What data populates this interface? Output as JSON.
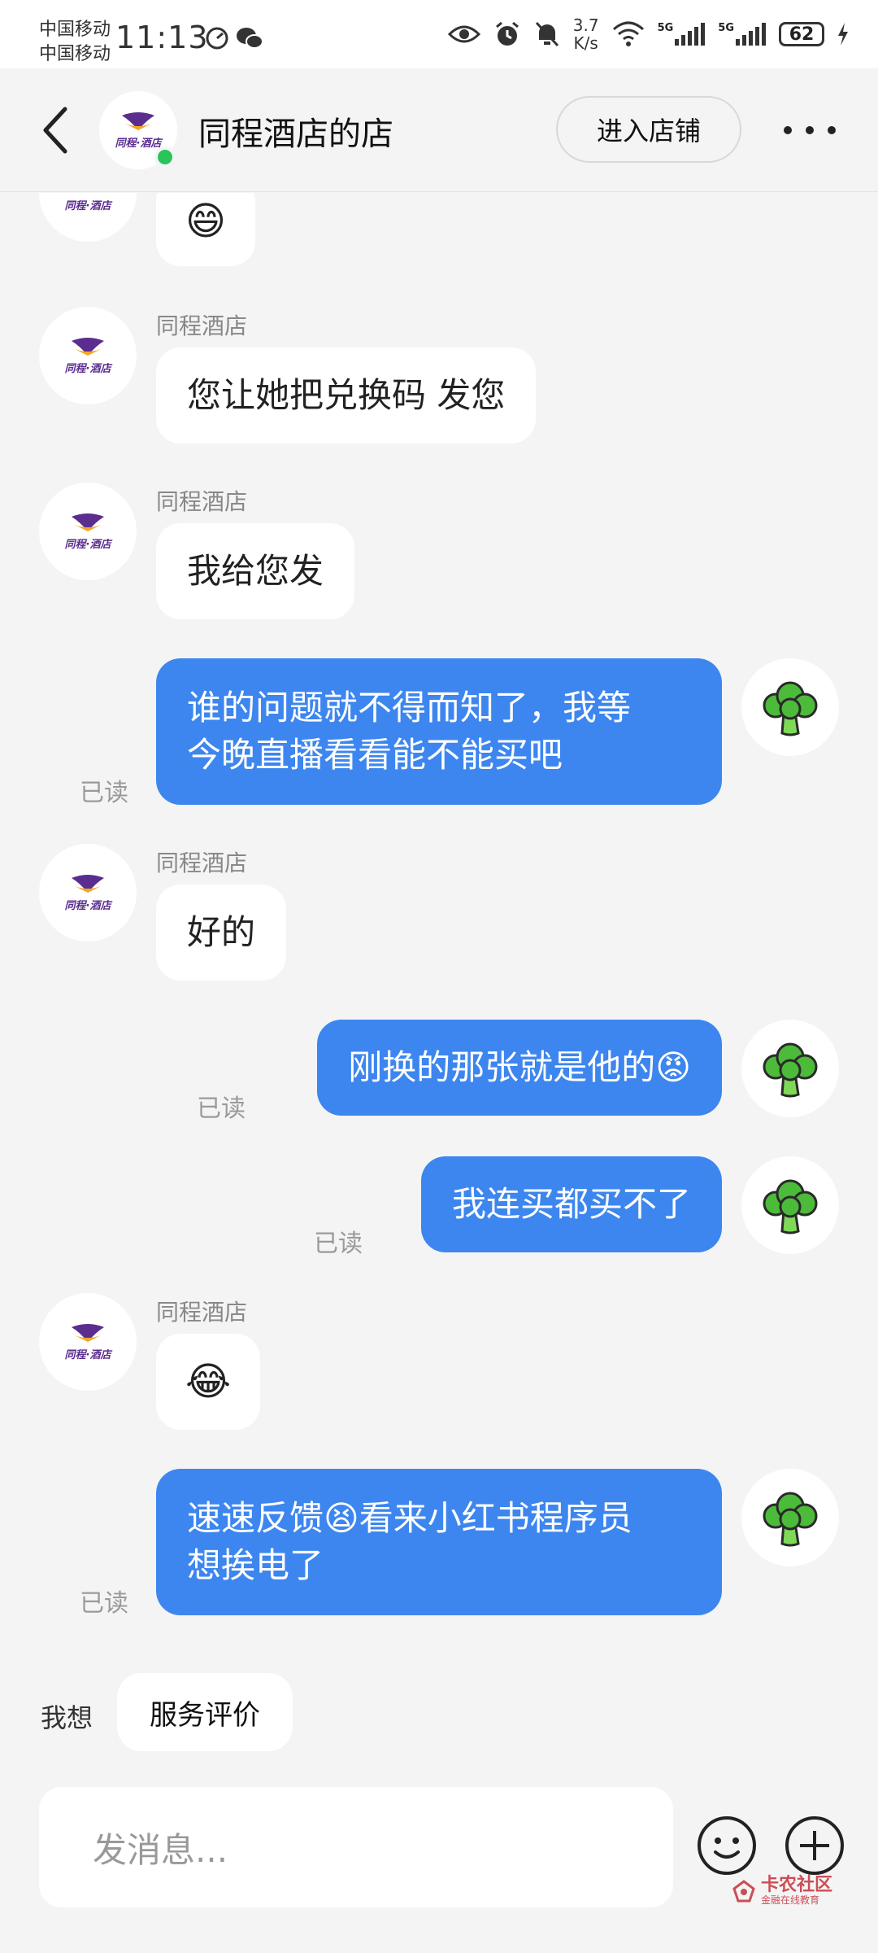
{
  "status_bar": {
    "carrier_1": "中国移动",
    "carrier_2": "中国移动",
    "time": "11:13",
    "net_speed_value": "3.7",
    "net_speed_unit": "K/s",
    "signal_1_label": "5G",
    "signal_2_label": "5G",
    "battery": "62"
  },
  "header": {
    "shop_name": "同程酒店的店",
    "enter_shop_label": "进入店铺",
    "logo_text": "同程·酒店",
    "online_status_color": "#2bc45a"
  },
  "chat": {
    "partial_top_emoji": "😄",
    "messages": [
      {
        "sender": "同程酒店",
        "text": "您让她把兑换码 发您"
      },
      {
        "sender": "同程酒店",
        "text": "我给您发"
      },
      {
        "text_line_1": "谁的问题就不得而知了，我等",
        "text_line_2": "今晚直播看看能不能买吧",
        "status": "已读"
      },
      {
        "sender": "同程酒店",
        "text": "好的"
      },
      {
        "text": "刚换的那张就是他的😡",
        "status": "已读"
      },
      {
        "text": "我连买都买不了",
        "status": "已读"
      },
      {
        "sender": "同程酒店",
        "text": "😂"
      },
      {
        "text_line_1": "速速反馈😫看来小红书程序员",
        "text_line_2": "想挨电了",
        "status": "已读"
      }
    ]
  },
  "bottom": {
    "want_label": "我想",
    "quick_reply": "服务评价",
    "input_placeholder": "发消息..."
  },
  "watermark": {
    "title": "卡农社区",
    "subtitle": "金融在线教育"
  },
  "colors": {
    "outgoing_bubble": "#3d86ef",
    "incoming_bubble": "#ffffff",
    "background": "#f4f4f4",
    "logo_purple": "#5b2d8f",
    "logo_orange": "#f5a623",
    "broccoli_green": "#4cbb3a"
  }
}
